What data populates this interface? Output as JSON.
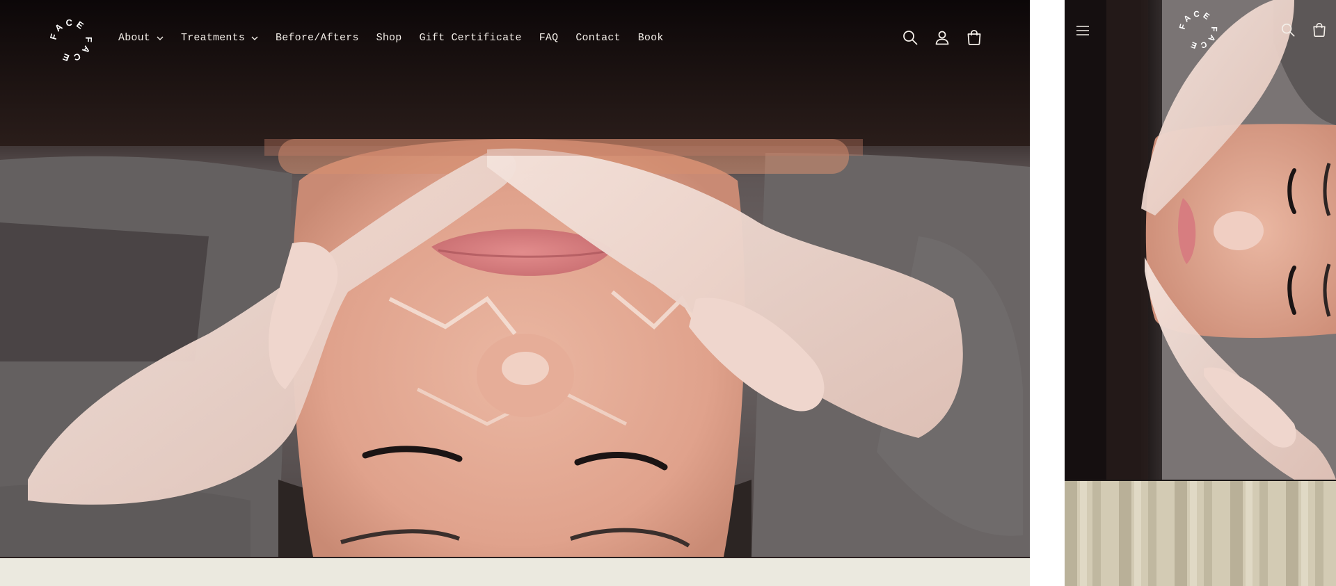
{
  "desktop": {
    "brand": {
      "logo_text": "FACE FACE",
      "logo_alt": "Face Face logo"
    },
    "nav": [
      {
        "label": "About",
        "has_dropdown": true,
        "icon": "chevron-down-icon"
      },
      {
        "label": "Treatments",
        "has_dropdown": true,
        "icon": "chevron-down-icon"
      },
      {
        "label": "Before/Afters",
        "has_dropdown": false
      },
      {
        "label": "Shop",
        "has_dropdown": false
      },
      {
        "label": "Gift Certificate",
        "has_dropdown": false
      },
      {
        "label": "FAQ",
        "has_dropdown": false
      },
      {
        "label": "Contact",
        "has_dropdown": false
      },
      {
        "label": "Book",
        "has_dropdown": false
      }
    ],
    "header_icons": [
      "search-icon",
      "account-icon",
      "cart-icon"
    ],
    "hero": {
      "media": "video still: facial treatment, gloved hands massaging cleanser on face"
    }
  },
  "mobile": {
    "header_icons": [
      "menu-icon",
      "search-icon",
      "cart-icon"
    ],
    "brand": {
      "logo_text": "FACE FACE"
    },
    "hero": {
      "media": "video still: facial treatment, rotated view"
    },
    "curtain": {
      "media": "linen curtain image"
    }
  },
  "colors": {
    "header_text": "#f4efe9",
    "page_background": "#ebe9df",
    "skin": "#e4a890",
    "glove": "#efd7cf",
    "sweater": "#6a6565"
  }
}
